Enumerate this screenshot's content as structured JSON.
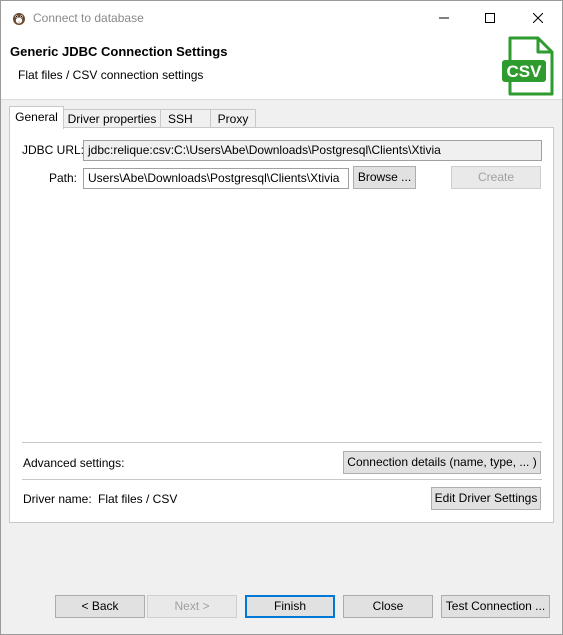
{
  "window": {
    "title": "Connect to database",
    "controls": {
      "minimize": "minimize",
      "maximize": "maximize",
      "close": "close"
    }
  },
  "header": {
    "title": "Generic JDBC Connection Settings",
    "subtitle": "Flat files / CSV connection settings",
    "logo_text": "CSV",
    "accent_color": "#2e9b2e"
  },
  "tabs": [
    {
      "label": "General",
      "active": true
    },
    {
      "label": "Driver properties",
      "active": false
    },
    {
      "label": "SSH",
      "active": false
    },
    {
      "label": "Proxy",
      "active": false
    }
  ],
  "general": {
    "jdbc_url_label": "JDBC URL:",
    "jdbc_url_value": "jdbc:relique:csv:C:\\Users\\Abe\\Downloads\\Postgresql\\Clients\\Xtivia",
    "path_label": "Path:",
    "path_value": "Users\\Abe\\Downloads\\Postgresql\\Clients\\Xtivia",
    "browse_label": "Browse ...",
    "create_label": "Create",
    "advanced_label": "Advanced settings:",
    "connection_details_label": "Connection details (name, type, ... )",
    "driver_name_label": "Driver name:",
    "driver_name_value": "Flat files / CSV",
    "edit_driver_label": "Edit Driver Settings"
  },
  "footer": {
    "back_label": "< Back",
    "next_label": "Next >",
    "finish_label": "Finish",
    "close_label": "Close",
    "test_label": "Test Connection ..."
  }
}
